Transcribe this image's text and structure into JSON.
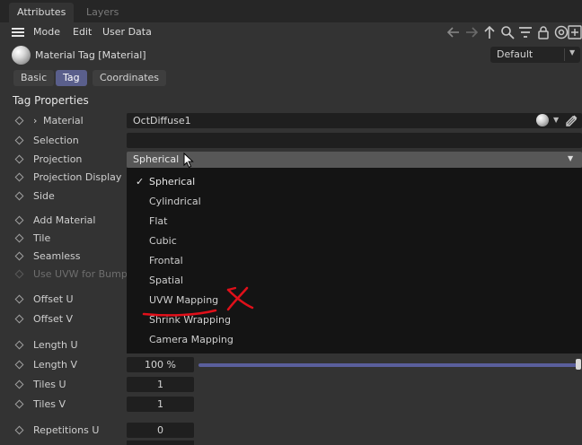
{
  "tabs": [
    {
      "label": "Attributes",
      "active": true
    },
    {
      "label": "Layers",
      "active": false
    }
  ],
  "menubar": {
    "items": [
      "Mode",
      "Edit",
      "User Data"
    ],
    "tool_icons": [
      "back-arrow-icon",
      "forward-arrow-icon",
      "up-arrow-icon",
      "search-icon",
      "filter-icon",
      "lock-icon",
      "target-icon",
      "add-panel-icon"
    ]
  },
  "header": {
    "title": "Material Tag [Material]",
    "preset": "Default"
  },
  "subtabs": [
    {
      "label": "Basic",
      "active": false
    },
    {
      "label": "Tag",
      "active": true
    },
    {
      "label": "Coordinates",
      "active": false
    }
  ],
  "section_title": "Tag Properties",
  "properties": {
    "material": {
      "label": "Material",
      "value": "OctDiffuse1"
    },
    "selection": {
      "label": "Selection",
      "value": ""
    },
    "projection": {
      "label": "Projection",
      "value": "Spherical"
    },
    "projection_display": {
      "label": "Projection Display"
    },
    "side": {
      "label": "Side"
    },
    "add_material": {
      "label": "Add Material"
    },
    "tile": {
      "label": "Tile"
    },
    "seamless": {
      "label": "Seamless"
    },
    "use_uvw_for_bump": {
      "label": "Use UVW for Bump"
    },
    "offset_u": {
      "label": "Offset U"
    },
    "offset_v": {
      "label": "Offset V"
    },
    "length_u": {
      "label": "Length U"
    },
    "length_v": {
      "label": "Length V",
      "value": "100 %",
      "slider_fraction": 1.0
    },
    "tiles_u": {
      "label": "Tiles U",
      "value": "1"
    },
    "tiles_v": {
      "label": "Tiles V",
      "value": "1"
    },
    "repetitions_u": {
      "label": "Repetitions U",
      "value": "0"
    }
  },
  "projection_dropdown": {
    "selected": "Spherical",
    "options": [
      "Spherical",
      "Cylindrical",
      "Flat",
      "Cubic",
      "Frontal",
      "Spatial",
      "UVW Mapping",
      "Shrink Wrapping",
      "Camera Mapping"
    ]
  },
  "annotation": {
    "color": "#e0101a"
  },
  "colors": {
    "panel_bg": "#333333",
    "field_bg": "#1f1f1f",
    "accent": "#5a5f8c",
    "dropdown_bg": "#141414"
  }
}
